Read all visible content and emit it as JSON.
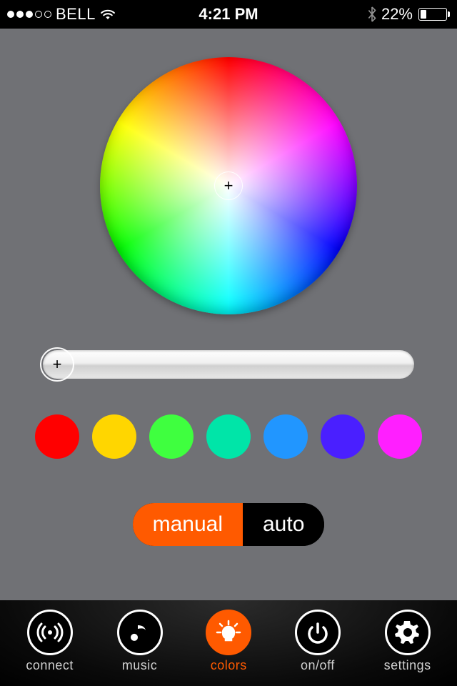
{
  "status_bar": {
    "carrier": "BELL",
    "signal_filled": 3,
    "signal_total": 5,
    "time": "4:21 PM",
    "battery_percent_text": "22%",
    "battery_percent": 22
  },
  "color_wheel": {
    "cursor_glyph": "+"
  },
  "brightness_slider": {
    "value": 0,
    "min": 0,
    "max": 100,
    "thumb_glyph": "+"
  },
  "preset_colors": [
    "#ff0000",
    "#ffd600",
    "#3fff3f",
    "#00e5a8",
    "#2196ff",
    "#4a1fff",
    "#ff1fff"
  ],
  "mode_toggle": {
    "options": [
      {
        "label": "manual",
        "active": true
      },
      {
        "label": "auto",
        "active": false
      }
    ]
  },
  "tabs": [
    {
      "id": "connect",
      "label": "connect",
      "active": false,
      "icon": "signal-icon"
    },
    {
      "id": "music",
      "label": "music",
      "active": false,
      "icon": "music-note-icon"
    },
    {
      "id": "colors",
      "label": "colors",
      "active": true,
      "icon": "bulb-icon"
    },
    {
      "id": "onoff",
      "label": "on/off",
      "active": false,
      "icon": "power-icon"
    },
    {
      "id": "settings",
      "label": "settings",
      "active": false,
      "icon": "gear-icon"
    }
  ]
}
